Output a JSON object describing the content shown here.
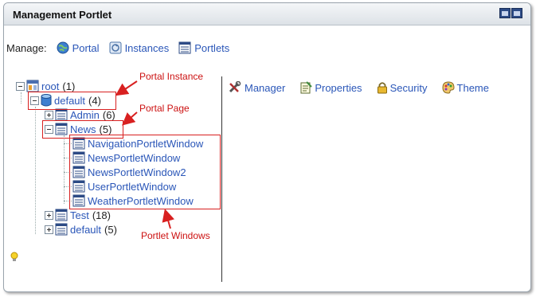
{
  "portlet": {
    "title": "Management Portlet"
  },
  "manage": {
    "label": "Manage:",
    "links": [
      "Portal",
      "Instances",
      "Portlets"
    ]
  },
  "tree": {
    "root": {
      "label": "root",
      "count": "(1)"
    },
    "instance": {
      "label": "default",
      "count": "(4)"
    },
    "pages": {
      "admin": {
        "label": "Admin",
        "count": "(6)"
      },
      "news": {
        "label": "News",
        "count": "(5)"
      },
      "test": {
        "label": "Test",
        "count": "(18)"
      },
      "default": {
        "label": "default",
        "count": "(5)"
      }
    },
    "windows": [
      "NavigationPortletWindow",
      "NewsPortletWindow",
      "NewsPortletWindow2",
      "UserPortletWindow",
      "WeatherPortletWindow"
    ]
  },
  "actions": [
    "Manager",
    "Properties",
    "Security",
    "Theme"
  ],
  "annotations": {
    "portal_instance": "Portal Instance",
    "portal_page": "Portal Page",
    "portlet_windows": "Portlet Windows"
  },
  "colors": {
    "link": "#2a56b8",
    "annotation": "#cc1111",
    "title_bar_top": "#f4f6f8",
    "title_bar_bottom": "#dde2e7"
  }
}
